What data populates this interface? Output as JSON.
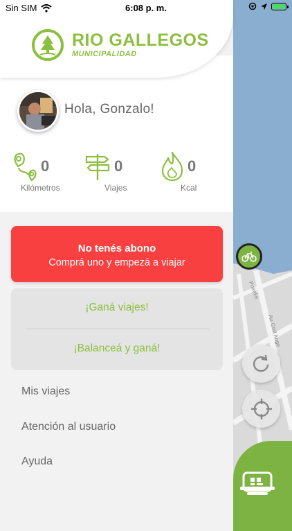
{
  "status_bar": {
    "carrier": "Sin SIM",
    "time": "6:08 p. m."
  },
  "header": {
    "logo_title": "RIO GALLEGOS",
    "logo_subtitle": "MUNICIPALIDAD"
  },
  "profile": {
    "greeting_prefix": "Hola, ",
    "name": "Gonzalo!"
  },
  "stats": [
    {
      "value": "0",
      "label": "Kilómetros",
      "icon": "route-pin-icon"
    },
    {
      "value": "0",
      "label": "Viajes",
      "icon": "signpost-icon"
    },
    {
      "value": "0",
      "label": "Kcal",
      "icon": "flame-icon"
    }
  ],
  "subscription_card": {
    "title": "No tenés abono",
    "subtitle": "Comprá uno y empezá a viajar"
  },
  "promo_card": {
    "option1": "¡Ganá viajes!",
    "option2": "¡Balanceá y ganá!"
  },
  "menu": {
    "item1": "Mis viajes",
    "item2": "Atención al usuario",
    "item3": "Ayuda"
  },
  "map": {
    "street1": "Au Gral Ange",
    "street2": "Pokeke"
  },
  "colors": {
    "brand_green": "#8cbf3f",
    "alert_red": "#f94040",
    "water_blue": "#8aaed0"
  }
}
